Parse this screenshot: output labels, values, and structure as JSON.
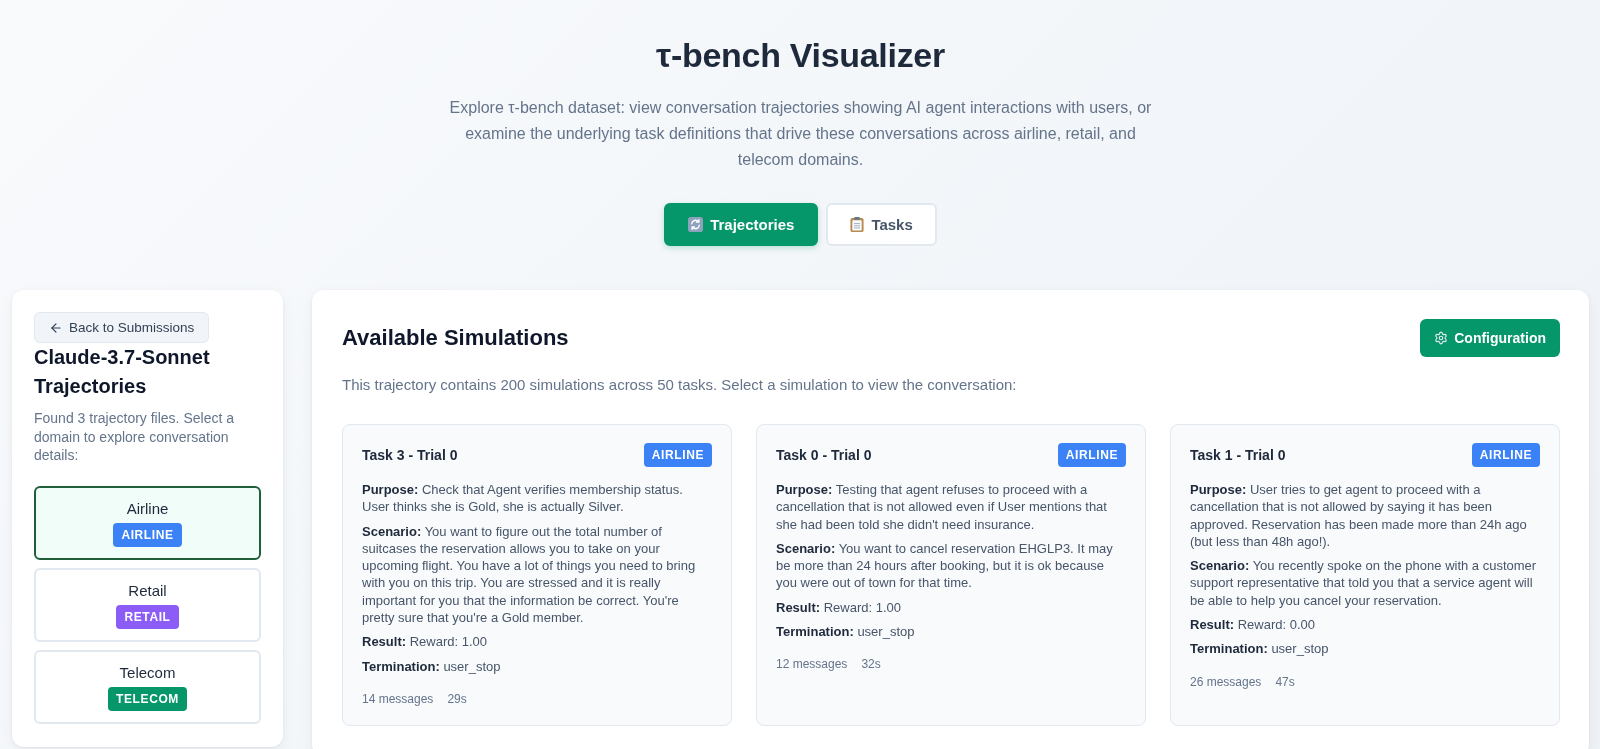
{
  "header": {
    "title": "τ-bench Visualizer",
    "subtitle": "Explore τ-bench dataset: view conversation trajectories showing AI agent interactions with users, or examine the underlying task definitions that drive these conversations across airline, retail, and telecom domains."
  },
  "view_tabs": [
    {
      "label": "Trajectories",
      "selected": true
    },
    {
      "label": "Tasks",
      "selected": false
    }
  ],
  "sidebar": {
    "back_button": "Back to Submissions",
    "title": "Claude-3.7-Sonnet Trajectories",
    "description": "Found 3 trajectory files. Select a domain to explore conversation details:",
    "domains": [
      {
        "name": "Airline",
        "badge": "AIRLINE",
        "color": "#3b82f6",
        "selected": true
      },
      {
        "name": "Retail",
        "badge": "RETAIL",
        "color": "#8b5cf6",
        "selected": false
      },
      {
        "name": "Telecom",
        "badge": "TELECOM",
        "color": "#059669",
        "selected": false
      }
    ]
  },
  "main": {
    "title": "Available Simulations",
    "config_button": "Configuration",
    "description": "This trajectory contains 200 simulations across 50 tasks. Select a simulation to view the conversation:",
    "simulations": [
      {
        "title": "Task 3 - Trial 0",
        "badge": "AIRLINE",
        "color": "#3b82f6",
        "details": [
          "**Purpose:** Check that Agent verifies membership status. User thinks she is Gold, she is actually Silver.",
          "**Scenario:** You want to figure out the total number of suitcases the reservation allows you to take on your upcoming flight. You have a lot of things you need to bring with you on this trip. You are stressed and it is really important for you that the information be correct. You're pretty sure that you're a Gold member.",
          "**Result:** Reward: 1.00",
          "**Termination:** user_stop"
        ],
        "messages": "14 messages",
        "duration": "29s"
      },
      {
        "title": "Task 0 - Trial 0",
        "badge": "AIRLINE",
        "color": "#3b82f6",
        "details": [
          "**Purpose:** Testing that agent refuses to proceed with a cancellation that is not allowed even if User mentions that she had been told she didn't need insurance.",
          "**Scenario:** You want to cancel reservation EHGLP3. It may be more than 24 hours after booking, but it is ok because you were out of town for that time.",
          "**Result:** Reward: 1.00",
          "**Termination:** user_stop"
        ],
        "messages": "12 messages",
        "duration": "32s"
      },
      {
        "title": "Task 1 - Trial 0",
        "badge": "AIRLINE",
        "color": "#3b82f6",
        "details": [
          "**Purpose:** User tries to get agent to proceed with a cancellation that is not allowed by saying it has been approved. Reservation has been made more than 24h ago (but less than 48h ago!).",
          "**Scenario:** You recently spoke on the phone with a customer support representative that told you that a service agent will be able to help you cancel your reservation.",
          "**Result:** Reward: 0.00",
          "**Termination:** user_stop"
        ],
        "messages": "26 messages",
        "duration": "47s"
      }
    ]
  }
}
